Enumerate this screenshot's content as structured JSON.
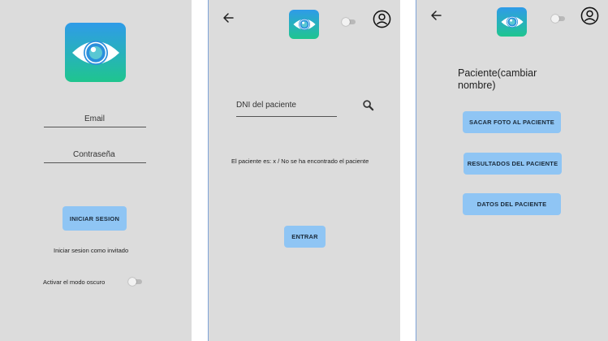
{
  "login": {
    "email_label": "Email",
    "password_label": "Contraseña",
    "login_button": "INICIAR SESION",
    "guest_link": "Iniciar sesion como invitado",
    "dark_mode_label": "Activar el modo oscuro",
    "dark_mode_on": false
  },
  "search": {
    "dni_placeholder": "DNI del paciente",
    "result_text": "El paciente es: x / No se ha encontrado el paciente",
    "enter_button": "ENTRAR",
    "toggle_on": false
  },
  "patient": {
    "title": "Paciente(cambiar nombre)",
    "photo_button": "SACAR FOTO AL PACIENTE",
    "results_button": "RESULTADOS DEL PACIENTE",
    "data_button": "DATOS DEL PACIENTE",
    "toggle_on": false
  },
  "icons": {
    "logo": "eye-icon",
    "back": "arrow-left-icon",
    "account": "account-circle-icon",
    "search": "search-icon"
  },
  "colors": {
    "button": "#8fc5f4",
    "screen_bg": "#dcdcdc",
    "logo_top": "#2f9be8",
    "logo_bottom": "#1fc58e"
  }
}
